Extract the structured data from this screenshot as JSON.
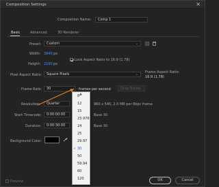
{
  "window": {
    "title": "Composition Settings",
    "close_glyph": "✕"
  },
  "comp_name": {
    "label": "Composition Name:",
    "value": "Comp 1"
  },
  "tabs": [
    {
      "label": "Basic"
    },
    {
      "label": "Advanced"
    },
    {
      "label": "3D Renderer"
    }
  ],
  "preset": {
    "label": "Preset:",
    "value": "Custom"
  },
  "width": {
    "label": "Width:",
    "value": "3840",
    "unit": "px"
  },
  "height": {
    "label": "Height:",
    "value": "2160",
    "unit": "px"
  },
  "lock_aspect": {
    "label": "Lock Aspect Ratio to 16:9 (1.78)",
    "checked": true
  },
  "pixel_aspect": {
    "label": "Pixel Aspect Ratio:",
    "value": "Square Pixels",
    "frame_aspect_label": "Frame Aspect Ratio:",
    "frame_aspect_value": "16:9 (1.78)"
  },
  "frame_rate": {
    "label": "Frame Rate:",
    "value": "30",
    "unit": "frames per second",
    "drop_frame": "Drop Frame"
  },
  "resolution": {
    "label": "Resolution:",
    "value": "Quarter",
    "info": "960 x 540, 2.0 MB per 8bpc frame"
  },
  "start_timecode": {
    "label": "Start Timecode:",
    "value": "0:00:00:00",
    "info": "Base 30"
  },
  "duration": {
    "label": "Duration:",
    "value": "0:00:30:00",
    "info": "Base 30"
  },
  "background": {
    "label": "Background Color:",
    "color": "#000000"
  },
  "frame_rate_options": {
    "caret": "▲",
    "items": [
      "8",
      "12",
      "15",
      "23.976",
      "24",
      "25",
      "29.97",
      "30",
      "50",
      "59.94",
      "60",
      "120"
    ],
    "selected": "30",
    "check": "✓"
  },
  "footer": {
    "preview_label": "Preview",
    "ok": "OK",
    "cancel": "Cancel"
  },
  "colors": {
    "accent_blue": "#4c8ef2",
    "arrow_orange": "#e0801c"
  }
}
